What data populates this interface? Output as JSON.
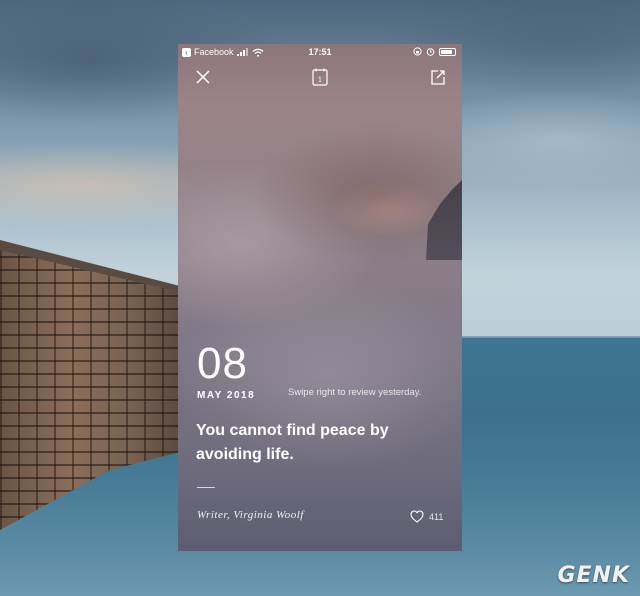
{
  "status_bar": {
    "back_app": "Facebook",
    "time": "17:51"
  },
  "toolbar": {
    "calendar_day": "1"
  },
  "card": {
    "day": "08",
    "month_year": "MAY 2018",
    "swipe_hint": "Swipe right to review yesterday.",
    "quote": "You cannot find peace by avoiding life.",
    "author": "Writer, Virginia Woolf",
    "likes": "411"
  },
  "watermark": "GENK",
  "icons": [
    "back-icon",
    "signal-icon",
    "wifi-icon",
    "lock-rotation-icon",
    "alarm-icon",
    "battery-icon",
    "close-icon",
    "calendar-icon",
    "share-icon",
    "heart-icon"
  ]
}
